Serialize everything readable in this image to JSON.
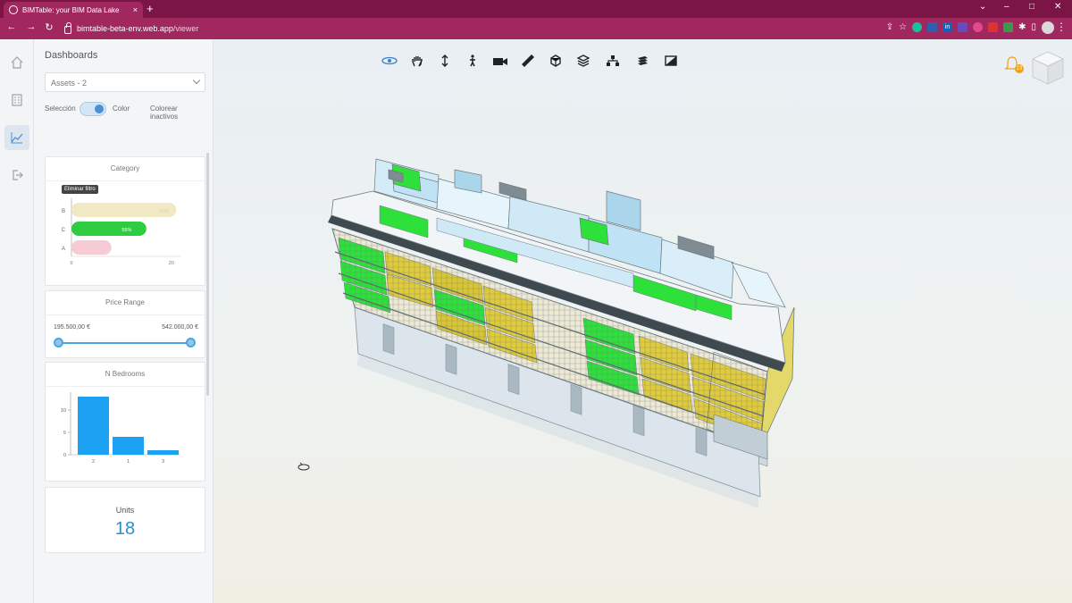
{
  "browser": {
    "tab_title": "BIMTable: your BIM Data Lake",
    "tab_close": "×",
    "new_tab": "+",
    "url_host": "bimtable-beta-env.web.app",
    "url_path": "/viewer",
    "window_controls": {
      "chevron": "⌄",
      "minimize": "–",
      "maximize": "□",
      "close": "✕"
    },
    "nav": {
      "back": "←",
      "forward": "→",
      "reload": "↻",
      "home": "⌂"
    },
    "extensions": [
      "share-icon",
      "star-icon",
      "grammarly-icon",
      "bookmark-icon",
      "linkedin-icon",
      "acrobat-icon",
      "camera-icon",
      "pdf-icon",
      "puzzle-icon",
      "sidebar-icon"
    ],
    "extension_labels": {
      "linkedin": "in",
      "menu": "⋮"
    },
    "accent": "#a0285f"
  },
  "rail": {
    "items": [
      "home-icon",
      "building-icon",
      "chart-icon",
      "logout-icon"
    ],
    "active": "chart-icon"
  },
  "dashboards": {
    "title": "Dashboards",
    "select_value": "Assets - 2",
    "toggle": {
      "left_label": "Selección",
      "right_label": "Color",
      "state": "on"
    },
    "recolor_label": "Colorear inactivos",
    "category_card": {
      "title": "Category",
      "tooltip": "Eliminar filtro",
      "chart_data": {
        "type": "bar",
        "orientation": "horizontal",
        "categories": [
          "B",
          "C",
          "A"
        ],
        "values": [
          21,
          15,
          8
        ],
        "data_labels": [
          "37%",
          "55%",
          ""
        ],
        "colors": [
          "#f0e9c4",
          "#2ecc40",
          "#f6cbd3"
        ],
        "xticks": [
          "0",
          "20"
        ],
        "xlim": [
          0,
          22
        ]
      }
    },
    "price_card": {
      "title": "Price Range",
      "min_value": "195.500,00 €",
      "max_value": "542.000,00 €"
    },
    "bedrooms_card": {
      "title": "N Bedrooms",
      "chart_data": {
        "type": "bar",
        "categories": [
          "2",
          "1",
          "3"
        ],
        "values": [
          13,
          4,
          1
        ],
        "ylim": [
          0,
          14
        ],
        "yticks": [
          "0",
          "5",
          "10"
        ],
        "color": "#1da1f2"
      }
    },
    "units_card": {
      "label": "Units",
      "value": "18"
    }
  },
  "viewer": {
    "tools": [
      "orbit-icon",
      "pan-icon",
      "zoom-icon",
      "walk-icon",
      "camera-icon",
      "measure-icon",
      "section-icon",
      "explode-icon",
      "model-tree-icon",
      "layers-icon",
      "properties-icon"
    ],
    "notification_count": "13"
  }
}
